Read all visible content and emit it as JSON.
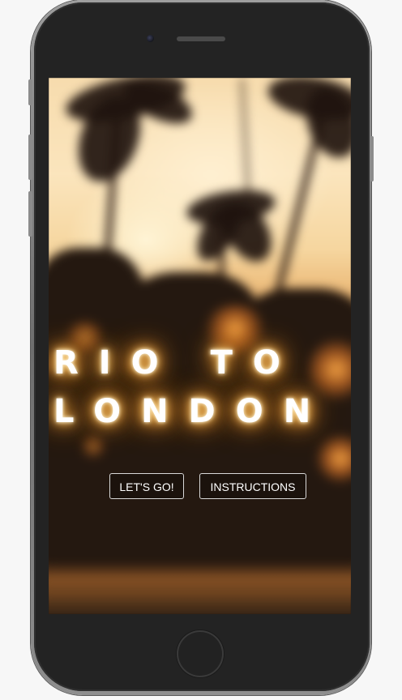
{
  "game": {
    "title_line_1": "RIO TO",
    "title_line_2": "LONDON",
    "buttons": {
      "start_label": "LET'S GO!",
      "instructions_label": "INSTRUCTIONS"
    }
  },
  "device": {
    "frame_color": "#232323",
    "shell_color": "#8c8c8c",
    "camera_icon": "camera-icon",
    "speaker_icon": "speaker-grille-icon",
    "home_button_icon": "home-button-icon"
  },
  "theme": {
    "title_glow_color": "#ffb347",
    "button_border_color": "#d8d8d8",
    "background_top_color": "#f7dcae",
    "background_bottom_color": "#1e1612"
  }
}
